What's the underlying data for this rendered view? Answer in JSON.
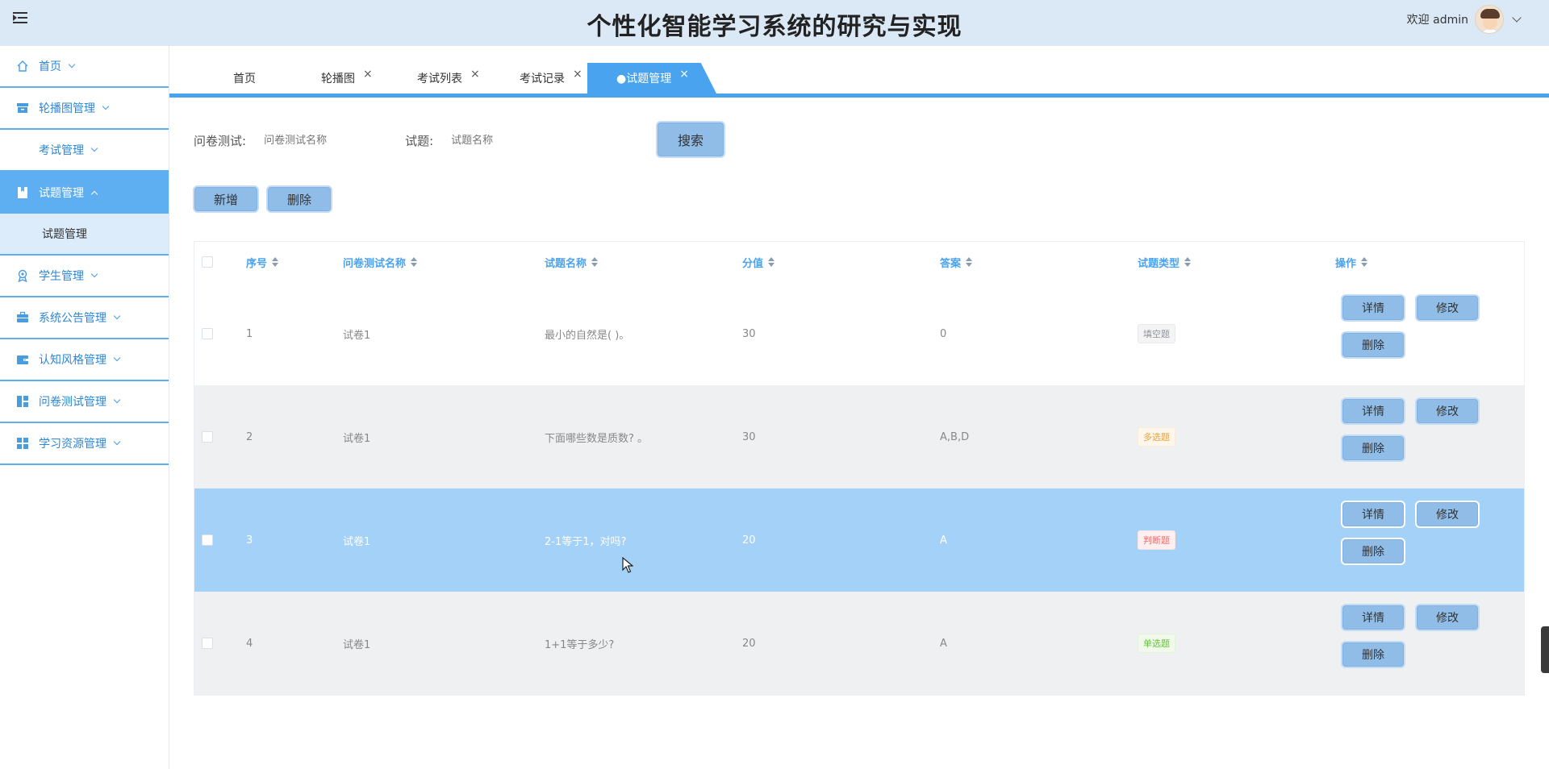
{
  "header": {
    "title": "个性化智能学习系统的研究与实现",
    "welcome": "欢迎 admin"
  },
  "sidebar": {
    "items": [
      {
        "label": "首页",
        "icon": "home-icon"
      },
      {
        "label": "轮播图管理",
        "icon": "archive-icon"
      },
      {
        "label": "考试管理",
        "icon": ""
      },
      {
        "label": "试题管理",
        "icon": "bookmark-icon",
        "active": true
      },
      {
        "label": "学生管理",
        "icon": "award-icon"
      },
      {
        "label": "系统公告管理",
        "icon": "briefcase-icon"
      },
      {
        "label": "认知风格管理",
        "icon": "wallet-icon"
      },
      {
        "label": "问卷测试管理",
        "icon": "dashboard-icon"
      },
      {
        "label": "学习资源管理",
        "icon": "grid-icon"
      }
    ],
    "submenu": [
      {
        "label": "试题管理"
      }
    ]
  },
  "tabs": [
    {
      "label": "首页",
      "closable": false
    },
    {
      "label": "轮播图",
      "closable": true
    },
    {
      "label": "考试列表",
      "closable": true
    },
    {
      "label": "考试记录",
      "closable": true
    },
    {
      "label": "●试题管理",
      "closable": true,
      "active": true
    }
  ],
  "tab_close": "×",
  "search": {
    "label1": "问卷测试:",
    "placeholder1": "问卷测试名称",
    "label2": "试题:",
    "placeholder2": "试题名称",
    "button": "搜索"
  },
  "actions": {
    "add": "新增",
    "delete": "删除"
  },
  "table": {
    "headers": [
      "序号",
      "问卷测试名称",
      "试题名称",
      "分值",
      "答案",
      "试题类型",
      "操作"
    ],
    "rows": [
      {
        "no": "1",
        "paper": "试卷1",
        "name": "最小的自然是( )。",
        "score": "30",
        "answer": "0",
        "type": "填空题",
        "type_style": "fill"
      },
      {
        "no": "2",
        "paper": "试卷1",
        "name": "下面哪些数是质数? 。",
        "score": "30",
        "answer": "A,B,D",
        "type": "多选题",
        "type_style": "multi"
      },
      {
        "no": "3",
        "paper": "试卷1",
        "name": "2-1等于1，对吗?",
        "score": "20",
        "answer": "A",
        "type": "判断题",
        "type_style": "judge"
      },
      {
        "no": "4",
        "paper": "试卷1",
        "name": "1+1等于多少?",
        "score": "20",
        "answer": "A",
        "type": "单选题",
        "type_style": "single"
      }
    ],
    "ops": {
      "detail": "详情",
      "edit": "修改",
      "delete": "删除"
    }
  },
  "colors": {
    "accent": "#4aa3ee",
    "header_bg": "#dbe8f5",
    "button_bg": "#8fbde8",
    "selected_row": "#a4d1f8"
  }
}
